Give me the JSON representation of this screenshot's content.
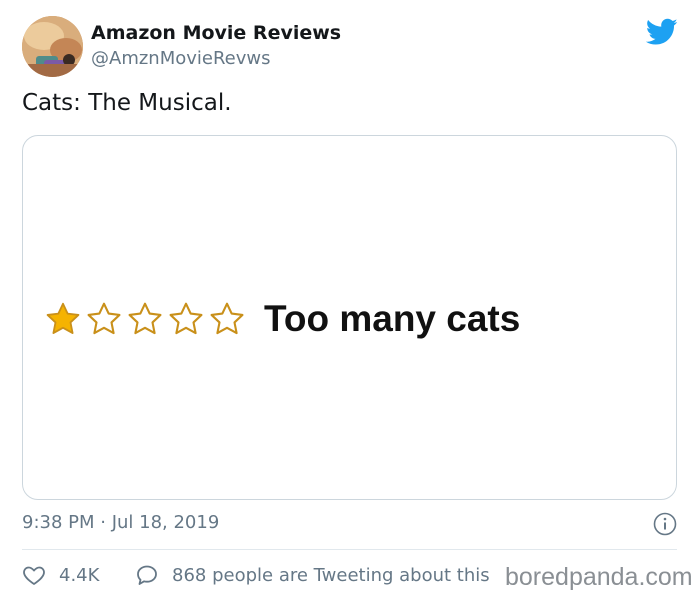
{
  "author": {
    "name": "Amazon Movie Reviews",
    "handle": "@AmznMovieRevws",
    "avatar_icon": "avatar-image"
  },
  "brand": {
    "logo_icon": "twitter-bird-icon",
    "color": "#1da1f2"
  },
  "tweet": {
    "text": "Cats: The Musical.",
    "timestamp": "9:38 PM · Jul 18, 2019"
  },
  "review_image": {
    "rating": {
      "value": 1,
      "max": 5,
      "star_fill_color": "#f5b301",
      "star_outline_color": "#c9901a"
    },
    "title": "Too many cats"
  },
  "actions": {
    "like_icon": "heart-icon",
    "like_count": "4.4K",
    "reply_icon": "speech-bubble-icon",
    "reply_text": "868 people are Tweeting about this",
    "info_icon": "info-icon"
  },
  "watermark": "boredpanda.com",
  "colors": {
    "secondary_text": "#657786",
    "primary_text": "#14171a",
    "border": "#ccd6dd"
  }
}
